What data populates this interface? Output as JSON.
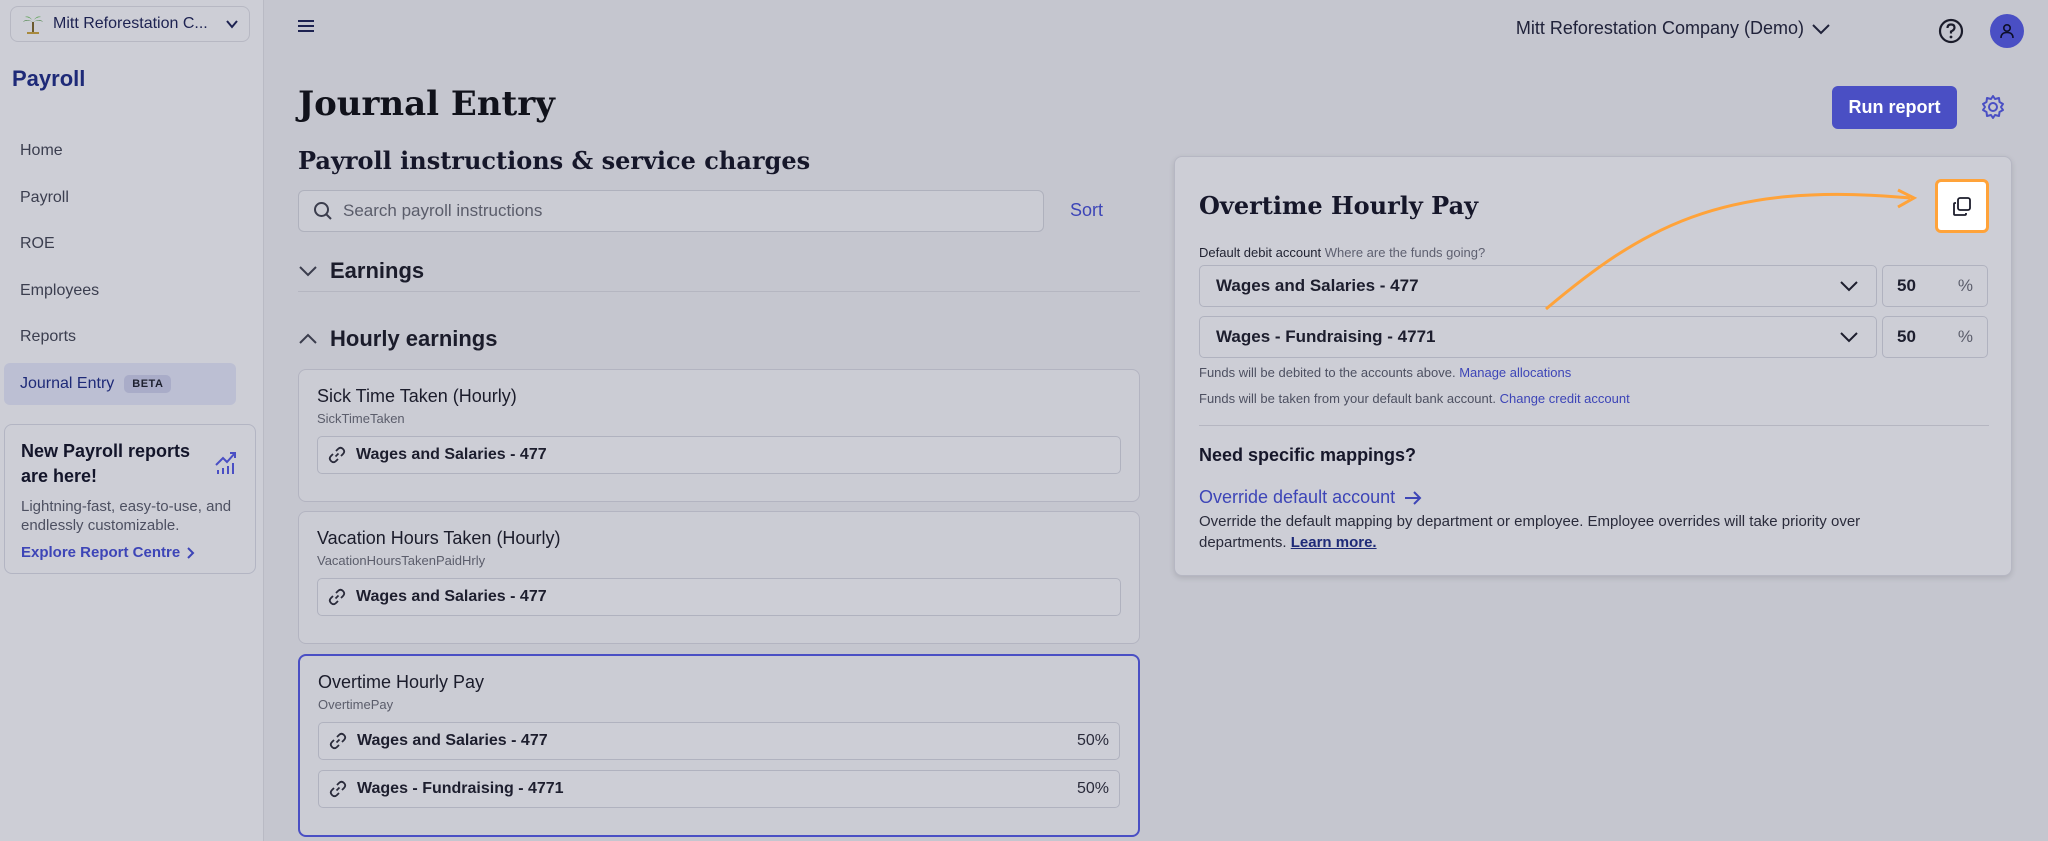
{
  "sidebar": {
    "company_name": "Mitt Reforestation C...",
    "brand": "Payroll",
    "items": [
      {
        "label": "Home"
      },
      {
        "label": "Payroll"
      },
      {
        "label": "ROE"
      },
      {
        "label": "Employees"
      },
      {
        "label": "Reports"
      },
      {
        "label": "Journal Entry",
        "badge": "BETA"
      }
    ],
    "promo": {
      "title": "New Payroll reports are here!",
      "body": "Lightning-fast, easy-to-use, and endlessly customizable.",
      "link": "Explore Report Centre"
    }
  },
  "header": {
    "company": "Mitt Reforestation Company (Demo)"
  },
  "main": {
    "title": "Journal Entry",
    "run_report": "Run report",
    "section_title": "Payroll instructions & service charges",
    "search_placeholder": "Search payroll instructions",
    "sort": "Sort",
    "groups": {
      "earnings": "Earnings",
      "hourly": "Hourly earnings"
    },
    "cards": [
      {
        "title": "Sick Time Taken (Hourly)",
        "code": "SickTimeTaken",
        "accounts": [
          {
            "name": "Wages and Salaries - 477",
            "pct": ""
          }
        ]
      },
      {
        "title": "Vacation Hours Taken (Hourly)",
        "code": "VacationHoursTakenPaidHrly",
        "accounts": [
          {
            "name": "Wages and Salaries - 477",
            "pct": ""
          }
        ]
      },
      {
        "title": "Overtime Hourly Pay",
        "code": "OvertimePay",
        "accounts": [
          {
            "name": "Wages and Salaries - 477",
            "pct": "50%"
          },
          {
            "name": "Wages - Fundraising - 4771",
            "pct": "50%"
          }
        ]
      }
    ]
  },
  "panel": {
    "title": "Overtime Hourly Pay",
    "debit_label": "Default debit account",
    "debit_hint": "Where are the funds going?",
    "rows": [
      {
        "account": "Wages and Salaries - 477",
        "pct": "50",
        "sym": "%"
      },
      {
        "account": "Wages - Fundraising - 4771",
        "pct": "50",
        "sym": "%"
      }
    ],
    "note1": "Funds will be debited to the accounts above.",
    "note1_link": "Manage allocations",
    "note2": "Funds will be taken from your default bank account.",
    "note2_link": "Change credit account",
    "need_title": "Need specific mappings?",
    "override_link": "Override default account",
    "override_desc": "Override the default mapping by department or employee. Employee overrides will take priority over departments.",
    "learn_more": "Learn more."
  },
  "colors": {
    "accent": "#4a4fc4",
    "highlight": "#ffa33a",
    "background": "#c5c6cf"
  }
}
